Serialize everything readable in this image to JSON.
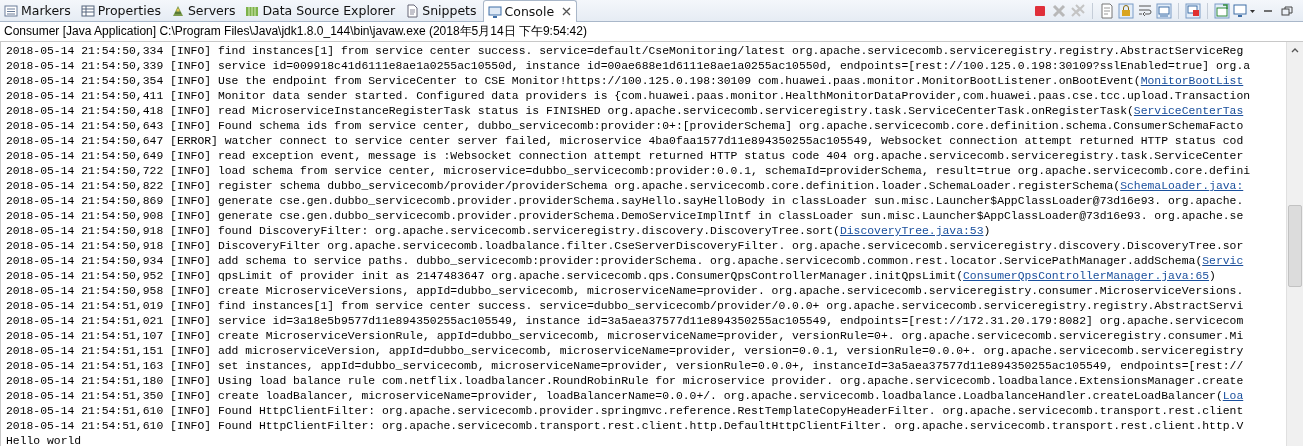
{
  "tabs": [
    {
      "label": "Markers",
      "selected": false
    },
    {
      "label": "Properties",
      "selected": false
    },
    {
      "label": "Servers",
      "selected": false
    },
    {
      "label": "Data Source Explorer",
      "selected": false
    },
    {
      "label": "Snippets",
      "selected": false
    },
    {
      "label": "Console",
      "selected": true
    }
  ],
  "console": {
    "title": "Consumer [Java Application] C:\\Program Files\\Java\\jdk1.8.0_144\\bin\\javaw.exe (2018年5月14日 下午9:54:42)",
    "lines": [
      {
        "text": "2018-05-14 21:54:50,334 [INFO] find instances[1] from service center success. service=default/CseMonitoring/latest org.apache.servicecomb.serviceregistry.registry.AbstractServiceReg"
      },
      {
        "text": "2018-05-14 21:54:50,339 [INFO] service id=009918c41d6111e8ae1a0255ac10550d, instance id=00ae688e1d6111e8ae1a0255ac10550d, endpoints=[rest://100.125.0.198:30109?sslEnabled=true] org.a"
      },
      {
        "text": "2018-05-14 21:54:50,354 [INFO] Use the endpoint from ServiceCenter to CSE Monitor!https://100.125.0.198:30109 com.huawei.paas.monitor.MonitorBootListener.onBootEvent(",
        "link": "MonitorBootList"
      },
      {
        "text": "2018-05-14 21:54:50,411 [INFO] Monitor data sender started. Configured data providers is {com.huawei.paas.monitor.HealthMonitorDataProvider,com.huawei.paas.cse.tcc.upload.Transaction"
      },
      {
        "text": "2018-05-14 21:54:50,418 [INFO] read MicroserviceInstanceRegisterTask status is FINISHED org.apache.servicecomb.serviceregistry.task.ServiceCenterTask.onRegisterTask(",
        "link": "ServiceCenterTas"
      },
      {
        "text": "2018-05-14 21:54:50,643 [INFO] Found schema ids from service center, dubbo_servicecomb:provider:0+:[providerSchema] org.apache.servicecomb.core.definition.schema.ConsumerSchemaFacto"
      },
      {
        "text": "2018-05-14 21:54:50,647 [ERROR] watcher connect to service center server failed, microservice 4ba0faa1577d11e894350255ac105549, Websocket connection attempt returned HTTP status cod"
      },
      {
        "text": "2018-05-14 21:54:50,649 [INFO] read exception event, message is :Websocket connection attempt returned HTTP status code 404 org.apache.servicecomb.serviceregistry.task.ServiceCenter"
      },
      {
        "text": "2018-05-14 21:54:50,722 [INFO] load schema from service center, microservice=dubbo_servicecomb:provider:0.0.1, schemaId=providerSchema, result=true org.apache.servicecomb.core.defini"
      },
      {
        "text": "2018-05-14 21:54:50,822 [INFO] register schema dubbo_servicecomb/provider/providerSchema org.apache.servicecomb.core.definition.loader.SchemaLoader.registerSchema(",
        "link": "SchemaLoader.java:"
      },
      {
        "text": "2018-05-14 21:54:50,869 [INFO] generate cse.gen.dubbo_servicecomb.provider.providerSchema.sayHello.sayHelloBody in classLoader sun.misc.Launcher$AppClassLoader@73d16e93. org.apache."
      },
      {
        "text": "2018-05-14 21:54:50,908 [INFO] generate cse.gen.dubbo_servicecomb.provider.providerSchema.DemoServiceImplIntf in classLoader sun.misc.Launcher$AppClassLoader@73d16e93. org.apache.se"
      },
      {
        "text": "2018-05-14 21:54:50,918 [INFO] found DiscoveryFilter: org.apache.servicecomb.serviceregistry.discovery.DiscoveryTree.sort(",
        "link": "DiscoveryTree.java:53",
        "after": ")"
      },
      {
        "text": "2018-05-14 21:54:50,918 [INFO] DiscoveryFilter org.apache.servicecomb.loadbalance.filter.CseServerDiscoveryFilter. org.apache.servicecomb.serviceregistry.discovery.DiscoveryTree.sor"
      },
      {
        "text": "2018-05-14 21:54:50,934 [INFO] add schema to service paths. dubbo_servicecomb:provider:providerSchema. org.apache.servicecomb.common.rest.locator.ServicePathManager.addSchema(",
        "link": "Servic"
      },
      {
        "text": "2018-05-14 21:54:50,952 [INFO] qpsLimit of provider init as 2147483647 org.apache.servicecomb.qps.ConsumerQpsControllerManager.initQpsLimit(",
        "link": "ConsumerQpsControllerManager.java:65",
        "after": ")"
      },
      {
        "text": "2018-05-14 21:54:50,958 [INFO] create MicroserviceVersions, appId=dubbo_servicecomb, microserviceName=provider. org.apache.servicecomb.serviceregistry.consumer.MicroserviceVersions."
      },
      {
        "text": "2018-05-14 21:54:51,019 [INFO] find instances[1] from service center success. service=dubbo_servicecomb/provider/0.0.0+ org.apache.servicecomb.serviceregistry.registry.AbstractServi"
      },
      {
        "text": "2018-05-14 21:54:51,021 [INFO] service id=3a18e5b9577d11e894350255ac105549, instance id=3a5aea37577d11e894350255ac105549, endpoints=[rest://172.31.20.179:8082] org.apache.servicecom"
      },
      {
        "text": "2018-05-14 21:54:51,107 [INFO] create MicroserviceVersionRule, appId=dubbo_servicecomb, microserviceName=provider, versionRule=0+. org.apache.servicecomb.serviceregistry.consumer.Mi"
      },
      {
        "text": "2018-05-14 21:54:51,151 [INFO] add microserviceVersion, appId=dubbo_servicecomb, microserviceName=provider, version=0.0.1, versionRule=0.0.0+. org.apache.servicecomb.serviceregistry"
      },
      {
        "text": "2018-05-14 21:54:51,163 [INFO] set instances, appId=dubbo_servicecomb, microserviceName=provider, versionRule=0.0.0+, instanceId=3a5aea37577d11e894350255ac105549, endpoints=[rest://"
      },
      {
        "text": "2018-05-14 21:54:51,180 [INFO] Using load balance rule com.netflix.loadbalancer.RoundRobinRule for microservice provider. org.apache.servicecomb.loadbalance.ExtensionsManager.create"
      },
      {
        "text": "2018-05-14 21:54:51,350 [INFO] create loadBalancer, microserviceName=provider, loadBalancerName=0.0.0+/. org.apache.servicecomb.loadbalance.LoadbalanceHandler.createLoadBalancer(",
        "link": "Loa"
      },
      {
        "text": "2018-05-14 21:54:51,610 [INFO] Found HttpClientFilter: org.apache.servicecomb.provider.springmvc.reference.RestTemplateCopyHeaderFilter. org.apache.servicecomb.transport.rest.client"
      },
      {
        "text": "2018-05-14 21:54:51,610 [INFO] Found HttpClientFilter: org.apache.servicecomb.transport.rest.client.http.DefaultHttpClientFilter. org.apache.servicecomb.transport.rest.client.http.V"
      },
      {
        "text": "Hello world"
      }
    ]
  }
}
